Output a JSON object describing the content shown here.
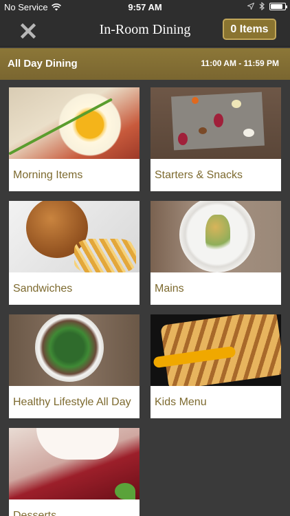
{
  "status_bar": {
    "carrier": "No Service",
    "time": "9:57 AM",
    "battery_level": 0.85
  },
  "nav": {
    "title": "In-Room Dining",
    "cart_label": "0 Items",
    "close_icon": "close-x-icon"
  },
  "section": {
    "title": "All Day Dining",
    "hours": "11:00 AM - 11:59 PM"
  },
  "menu": {
    "categories": [
      {
        "label": "Morning Items"
      },
      {
        "label": "Starters & Snacks"
      },
      {
        "label": "Sandwiches"
      },
      {
        "label": "Mains"
      },
      {
        "label": "Healthy Lifestyle All Day"
      },
      {
        "label": "Kids Menu"
      },
      {
        "label": "Desserts"
      }
    ]
  },
  "colors": {
    "accent_gold": "#8a7430",
    "label_text": "#7d6a2f",
    "background": "#3a3a3a"
  }
}
